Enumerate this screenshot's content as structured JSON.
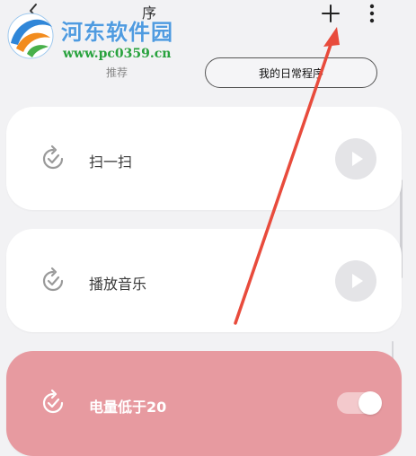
{
  "header": {
    "title_fragment": "序",
    "add_icon": "plus-icon",
    "more_icon": "more-vertical-icon",
    "back_icon": "back-arrow-icon"
  },
  "watermark": {
    "name": "河东软件园",
    "url": "www.pc0359.cn"
  },
  "tabs": [
    {
      "label": "推荐",
      "selected": false
    },
    {
      "label": "我的日常程序",
      "selected": true
    }
  ],
  "routines": [
    {
      "label": "扫一扫",
      "icon": "check-refresh-icon",
      "control": "play-icon",
      "active": false
    },
    {
      "label": "播放音乐",
      "icon": "check-refresh-icon",
      "control": "play-icon",
      "active": false
    },
    {
      "label": "电量低于20",
      "icon": "check-refresh-icon",
      "control": "toggle",
      "active": true,
      "toggle_on": true
    }
  ],
  "colors": {
    "background": "#f2f2f4",
    "card": "#ffffff",
    "active_card": "#e79aa0",
    "annotation_arrow": "#e84b3c",
    "watermark_name": "#4f9be0",
    "watermark_url": "#28a23d"
  }
}
